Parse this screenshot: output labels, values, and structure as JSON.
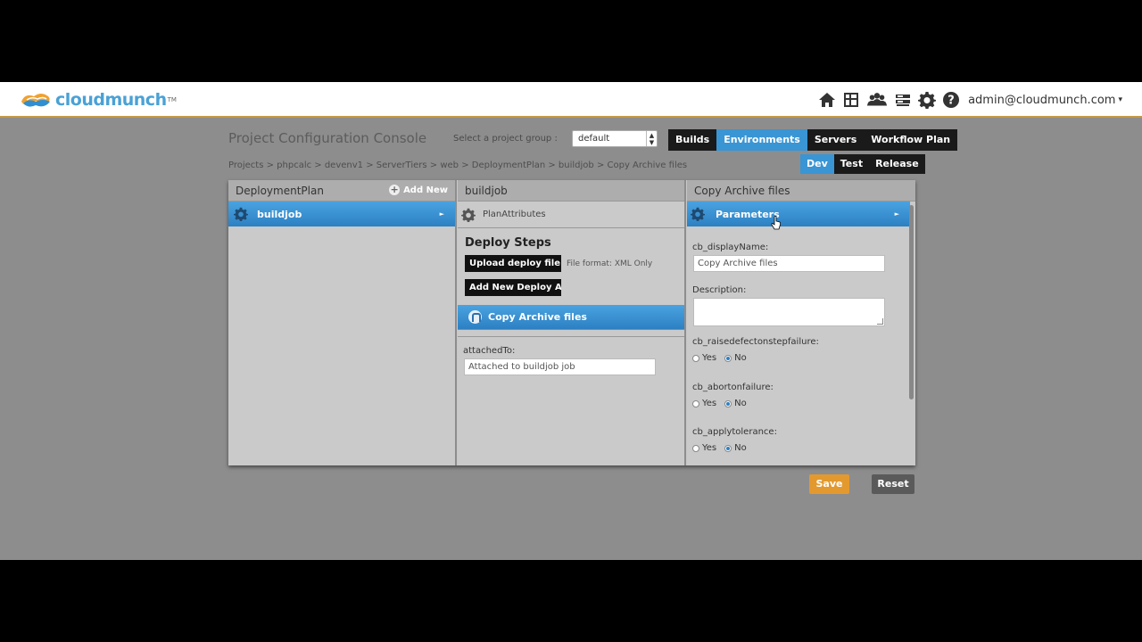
{
  "header": {
    "logo_text": "cloudmunch",
    "logo_tm": "TM",
    "user": "admin@cloudmunch.com",
    "icons": [
      "home-icon",
      "grid-icon",
      "users-icon",
      "servers-icon",
      "gear-icon",
      "help-icon"
    ]
  },
  "console": {
    "title": "Project Configuration Console",
    "group_label": "Select a project group :",
    "group_value": "default"
  },
  "nav_tabs": [
    {
      "label": "Builds",
      "active": false
    },
    {
      "label": "Environments",
      "active": true
    },
    {
      "label": "Servers",
      "active": false
    },
    {
      "label": "Workflow Plan",
      "active": false
    }
  ],
  "env_tabs": [
    {
      "label": "Dev",
      "active": true
    },
    {
      "label": "Test",
      "active": false
    },
    {
      "label": "Release",
      "active": false
    }
  ],
  "breadcrumb": "Projects > phpcalc > devenv1 > ServerTiers > web > DeploymentPlan > buildjob > Copy Archive files",
  "panel1": {
    "title": "DeploymentPlan",
    "add_new": "Add New",
    "item": "buildjob"
  },
  "panel2": {
    "title": "buildjob",
    "plan_attributes": "PlanAttributes",
    "deploy_steps": "Deploy Steps",
    "upload_btn": "Upload deploy file",
    "file_format": "File format: XML Only",
    "add_btn": "Add New Deploy App",
    "step": "Copy Archive files",
    "attached_label": "attachedTo:",
    "attached_value": "Attached to buildjob job"
  },
  "panel3": {
    "title": "Copy Archive files",
    "parameters": "Parameters",
    "display_name_label": "cb_displayName:",
    "display_name_value": "Copy Archive files",
    "description_label": "Description:",
    "raise_label": "cb_raisedefectonstepfailure:",
    "abort_label": "cb_abortonfailure:",
    "tolerance_label": "cb_applytolerance:",
    "yes": "Yes",
    "no": "No"
  },
  "actions": {
    "save": "Save",
    "reset": "Reset"
  },
  "colors": {
    "accent_blue": "#3a95d4",
    "save_orange": "#e3992e"
  }
}
